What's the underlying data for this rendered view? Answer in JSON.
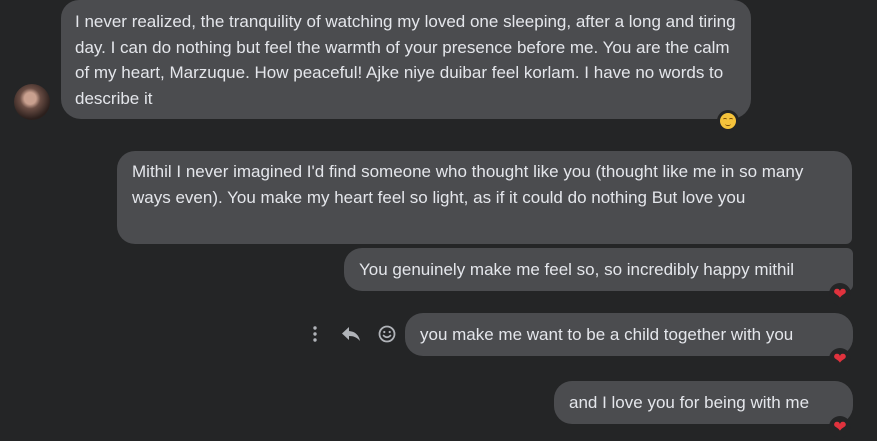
{
  "messages": [
    {
      "text": "I never realized, the tranquility of watching my loved one sleeping, after a long and tiring day. I can do nothing but feel the warmth of your presence before me. You are the calm of my heart, Marzuque. How peaceful! Ajke niye duibar feel korlam. I have no words to describe it",
      "reaction": "😌"
    },
    {
      "text": "Mithil I never imagined I'd find someone who thought like you (thought like me in so many ways even). You make my heart feel so light, as if it could do nothing But love you"
    },
    {
      "text": "You genuinely make me feel so, so incredibly happy mithil",
      "reaction": "❤"
    },
    {
      "text": "you make me want to be a child together with you",
      "reaction": "❤"
    },
    {
      "text": "and I love you for being with me",
      "reaction": "❤"
    }
  ],
  "actions": {
    "more_icon": "more-options-icon",
    "reply_icon": "reply-icon",
    "react_icon": "emoji-react-icon"
  },
  "colors": {
    "background": "#242526",
    "bubble": "#4b4c4f",
    "text": "#e4e6eb",
    "heart": "#e0323d"
  }
}
